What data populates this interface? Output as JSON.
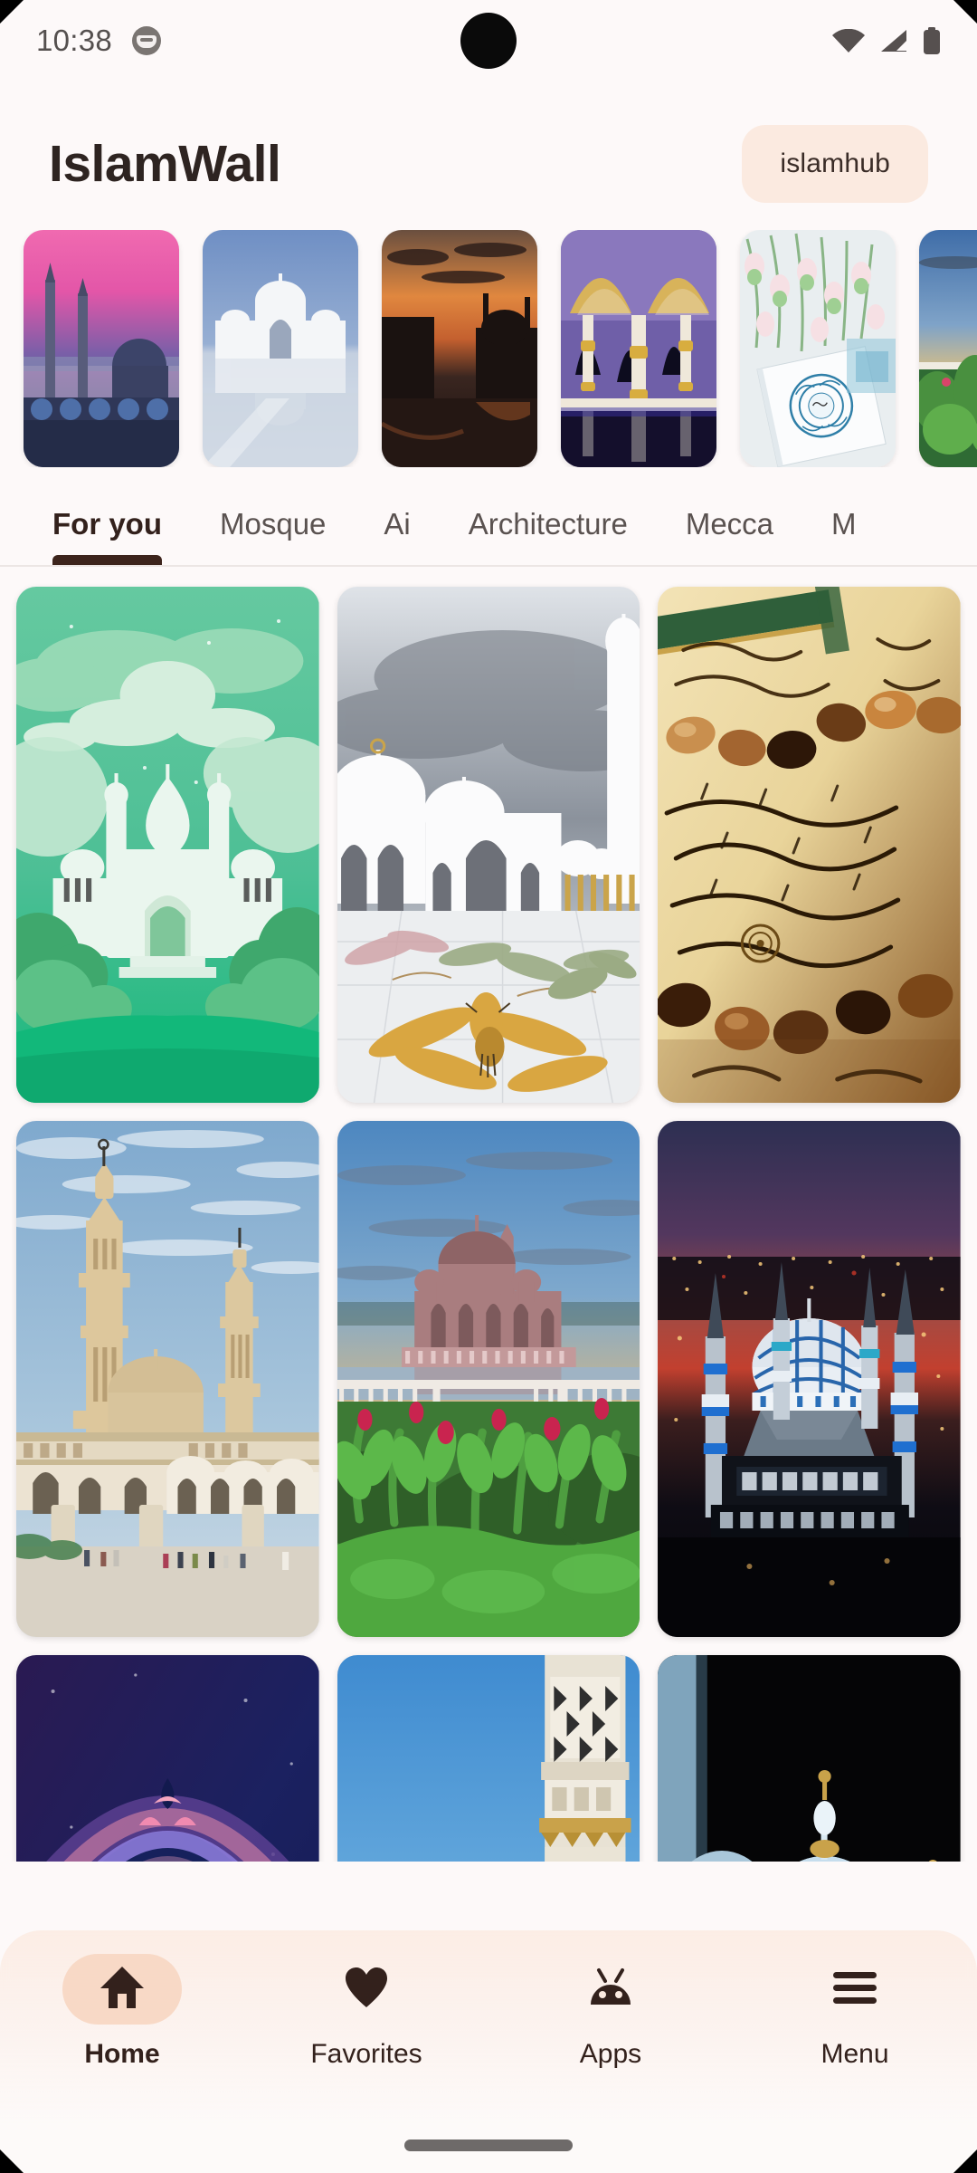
{
  "status_bar": {
    "time": "10:38",
    "app_icon": "android-notification-icon",
    "wifi_icon": "wifi-icon",
    "signal_icon": "cellular-signal-icon",
    "battery_icon": "battery-icon"
  },
  "header": {
    "title": "IslamWall",
    "hub_button_label": "islamhub"
  },
  "carousel": {
    "items": [
      {
        "name": "blue-mosque-istanbul-dusk",
        "alt": "Blue Mosque Istanbul at pink dusk"
      },
      {
        "name": "white-palace-reflection",
        "alt": "White palace mirrored in water"
      },
      {
        "name": "mosque-silhouette-sunset",
        "alt": "Dark mosque silhouette at orange sunset"
      },
      {
        "name": "golden-arches-interior",
        "alt": "Golden arches with purple interior"
      },
      {
        "name": "quran-with-flowers",
        "alt": "Open Quran with white flowers"
      },
      {
        "name": "garden-mosque-sunrise",
        "alt": "Mosque beyond green garden at sunrise"
      }
    ]
  },
  "tabs": {
    "items": [
      {
        "label": "For you",
        "active": true
      },
      {
        "label": "Mosque",
        "active": false
      },
      {
        "label": "Ai",
        "active": false
      },
      {
        "label": "Architecture",
        "active": false
      },
      {
        "label": "Mecca",
        "active": false
      },
      {
        "label": "M",
        "active": false
      }
    ]
  },
  "grid": {
    "items": [
      {
        "name": "green-paper-art-mosque",
        "alt": "Green paper-cut style mosque with clouds"
      },
      {
        "name": "sheikh-zayed-mosque-courtyard",
        "alt": "White mosque courtyard with floral marble inlay"
      },
      {
        "name": "quran-page-prayer-beads",
        "alt": "Quran page with wooden prayer beads"
      },
      {
        "name": "sandstone-mosque-minarets",
        "alt": "Sandstone mosque with two tall minarets"
      },
      {
        "name": "putra-mosque-flower-garden",
        "alt": "Pink mosque over lake with flower garden"
      },
      {
        "name": "blue-mosque-aerial-night",
        "alt": "Aerial blue-domed mosque at dusk over city"
      },
      {
        "name": "crescent-moon-arch",
        "alt": "Ornate purple arch with crescent moon"
      },
      {
        "name": "green-dome-nabawi",
        "alt": "Green dome of Masjid an-Nabawi"
      },
      {
        "name": "white-domes-night",
        "alt": "White domes lit against black night sky"
      }
    ]
  },
  "bottom_nav": {
    "items": [
      {
        "label": "Home",
        "icon": "home-icon",
        "active": true
      },
      {
        "label": "Favorites",
        "icon": "heart-icon",
        "active": false
      },
      {
        "label": "Apps",
        "icon": "android-icon",
        "active": false
      },
      {
        "label": "Menu",
        "icon": "hamburger-menu-icon",
        "active": false
      }
    ]
  },
  "colors": {
    "background": "#FDF9F9",
    "accent_peach": "#FBEAE0",
    "accent_peach_dark": "#F8D9C6",
    "text_dark": "#33211c",
    "tab_indicator": "#3d241c"
  }
}
